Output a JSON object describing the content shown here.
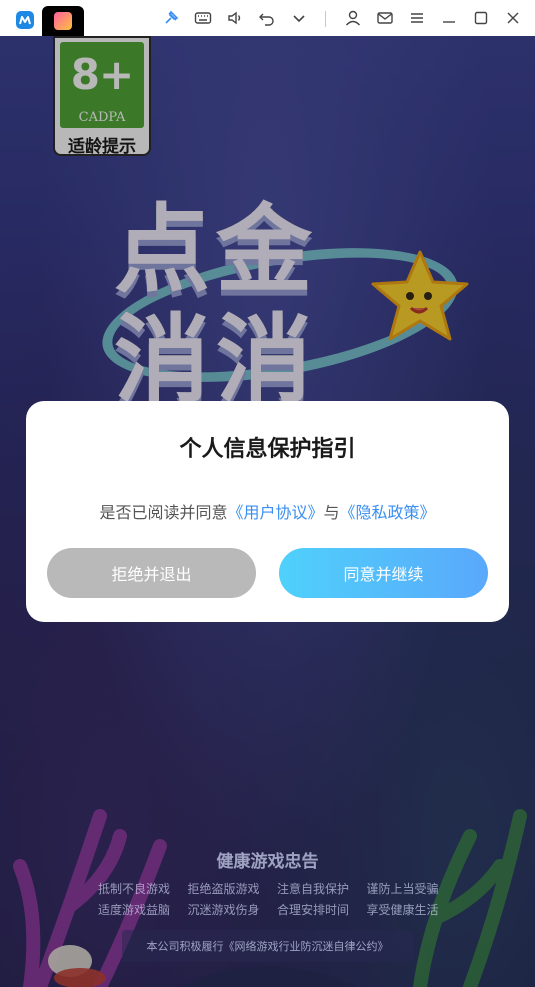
{
  "titlebar": {
    "icons": [
      "app-logo-icon",
      "game-tab-icon",
      "pin-icon",
      "keyboard-icon",
      "volume-icon",
      "undo-icon",
      "chevron-down-icon",
      "user-icon",
      "mail-icon",
      "menu-icon",
      "minimize-icon",
      "maximize-icon",
      "close-icon"
    ]
  },
  "age_rating": {
    "age": "8+",
    "org": "CADPA",
    "label": "适龄提示"
  },
  "game": {
    "title": "点金消消"
  },
  "dialog": {
    "title": "个人信息保护指引",
    "prefix": "是否已阅读并同意",
    "user_agreement": "《用户协议》",
    "and": "与",
    "privacy_policy": "《隐私政策》",
    "decline_label": "拒绝并退出",
    "agree_label": "同意并继续"
  },
  "health": {
    "title": "健康游戏忠告",
    "items": [
      "抵制不良游戏",
      "拒绝盗版游戏",
      "注意自我保护",
      "谨防上当受骗",
      "适度游戏益脑",
      "沉迷游戏伤身",
      "合理安排时间",
      "享受健康生活"
    ],
    "pledge": "本公司积极履行《网络游戏行业防沉迷自律公约》"
  },
  "colors": {
    "link": "#3a8ef2",
    "decline_bg": "#b9b9b9",
    "agree_start": "#4fd1fb",
    "agree_end": "#5aa8fb",
    "age_green": "#53a83a"
  }
}
